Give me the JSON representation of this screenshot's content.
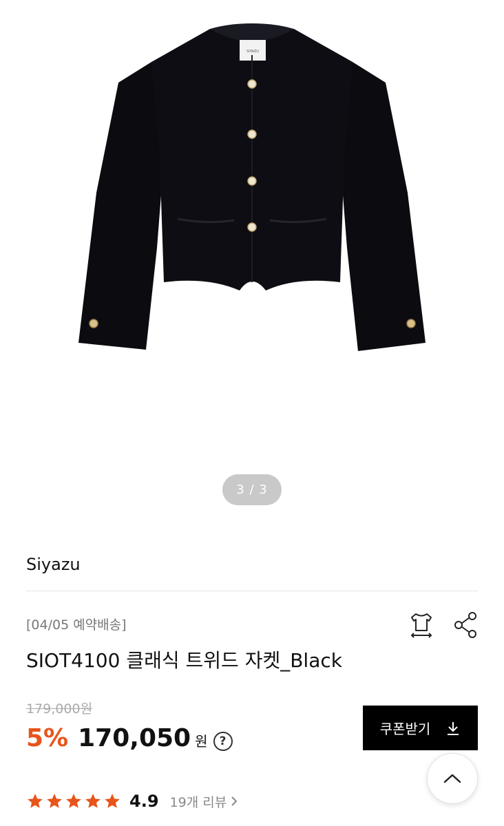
{
  "gallery": {
    "indicator": "3 / 3",
    "label_text": "SIYAZU"
  },
  "product": {
    "brand": "Siyazu",
    "delivery_tag": "[04/05 예약배송]",
    "title": "SIOT4100 클래식 트위드 자켓_Black",
    "original_price": "179,000원",
    "discount": "5%",
    "price": "170,050",
    "currency": "원",
    "help_symbol": "?"
  },
  "actions": {
    "coupon_label": "쿠폰받기",
    "fit_icon": "tshirt-size-icon",
    "share_icon": "share-icon",
    "scroll_top_icon": "chevron-up-icon"
  },
  "rating": {
    "value": "4.9",
    "stars": 5,
    "review_label": "19개 리뷰"
  },
  "colors": {
    "accent": "#e8541a",
    "button_bg": "#000000",
    "indicator_bg": "#c9c9c9"
  }
}
